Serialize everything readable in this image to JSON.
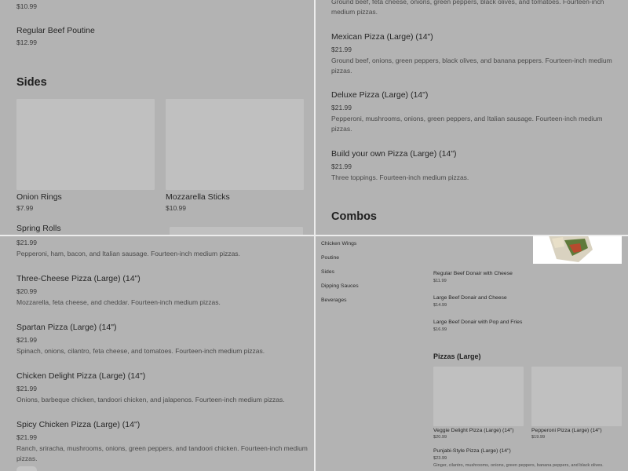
{
  "tl": {
    "top_price": "$10.99",
    "poutine": {
      "name": "Regular Beef Poutine",
      "price": "$12.99"
    },
    "sides_title": "Sides",
    "onion": {
      "name": "Onion Rings",
      "price": "$7.99"
    },
    "mozz": {
      "name": "Mozzarella Sticks",
      "price": "$10.99"
    },
    "spring": {
      "name": "Spring Rolls"
    }
  },
  "tr": {
    "top_desc": "Ground beef, feta cheese, onions, green peppers, black olives, and tomatoes. Fourteen-inch medium pizzas.",
    "mexican": {
      "name": "Mexican Pizza (Large) (14\")",
      "price": "$21.99",
      "desc": "Ground beef, onions, green peppers, black olives, and banana peppers. Fourteen-inch medium pizzas."
    },
    "deluxe": {
      "name": "Deluxe Pizza (Large) (14\")",
      "price": "$21.99",
      "desc": "Pepperoni, mushrooms, onions, green peppers, and Italian sausage. Fourteen-inch medium pizzas."
    },
    "byo": {
      "name": "Build your own Pizza (Large) (14\")",
      "price": "$21.99",
      "desc": "Three toppings. Fourteen-inch medium pizzas."
    },
    "combos_title": "Combos"
  },
  "bl": {
    "top_price": "$21.99",
    "top_desc": "Pepperoni, ham, bacon, and Italian sausage. Fourteen-inch medium pizzas.",
    "three": {
      "name": "Three-Cheese Pizza (Large) (14\")",
      "price": "$20.99",
      "desc": "Mozzarella, feta cheese, and cheddar. Fourteen-inch medium pizzas."
    },
    "spartan": {
      "name": "Spartan Pizza (Large) (14\")",
      "price": "$21.99",
      "desc": "Spinach, onions, cilantro, feta cheese, and tomatoes. Fourteen-inch medium pizzas."
    },
    "delight": {
      "name": "Chicken Delight Pizza (Large) (14\")",
      "price": "$21.99",
      "desc": "Onions, barbeque chicken, tandoori chicken, and jalapenos. Fourteen-inch medium pizzas."
    },
    "spicy": {
      "name": "Spicy Chicken Pizza (Large) (14\")",
      "price": "$21.99",
      "desc": "Ranch, sriracha, mushrooms, onions, green peppers, and tandoori chicken. Fourteen-inch medium pizzas."
    }
  },
  "br": {
    "nav": [
      "Chicken Wings",
      "Poutine",
      "Sides",
      "Dipping Sauces",
      "Beverages"
    ],
    "donair1": {
      "name": "Regular Beef Donair with Cheese",
      "price": "$11.99"
    },
    "donair2": {
      "name": "Large Beef Donair and Cheese",
      "price": "$14.99"
    },
    "donair3": {
      "name": "Large Beef Donair with Pop and Fries",
      "price": "$16.99"
    },
    "pizzas_title": "Pizzas (Large)",
    "veggie": {
      "name": "Veggie Delight Pizza (Large) (14\")",
      "price": "$20.99"
    },
    "pepperoni": {
      "name": "Pepperoni Pizza (Large) (14\")",
      "price": "$19.99"
    },
    "punjabi": {
      "name": "Punjabi-Style Pizza (Large) (14\")",
      "price": "$23.99",
      "desc": "Ginger, cilantro, mushrooms, onions, green peppers, banana peppers, and black olives."
    }
  }
}
